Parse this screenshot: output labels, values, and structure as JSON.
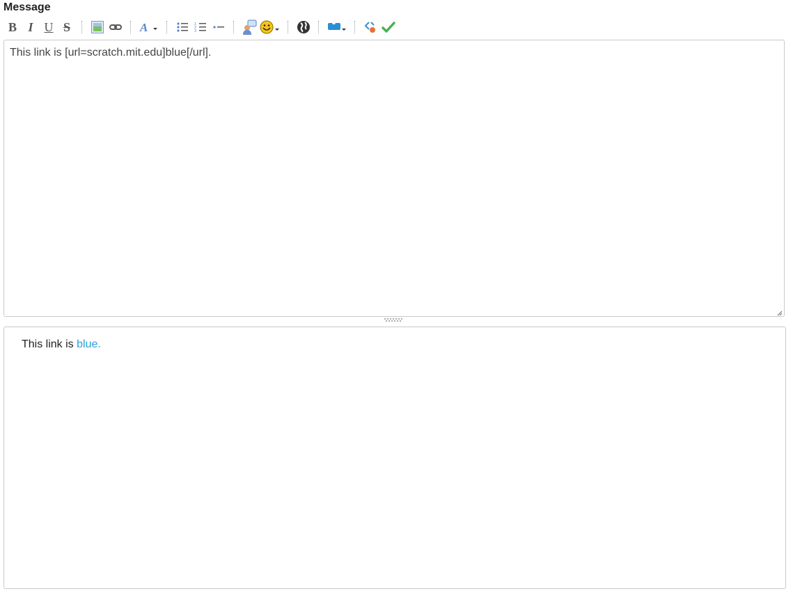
{
  "field_label": "Message",
  "toolbar": {
    "bold_label": "B",
    "italic_label": "I",
    "underline_label": "U",
    "strike_label": "S",
    "buttons": [
      {
        "name": "bold",
        "icon": "bold-icon"
      },
      {
        "name": "italic",
        "icon": "italic-icon"
      },
      {
        "name": "underline",
        "icon": "underline-icon"
      },
      {
        "name": "strikethrough",
        "icon": "strikethrough-icon"
      },
      {
        "name": "image",
        "icon": "image-icon"
      },
      {
        "name": "link",
        "icon": "link-icon"
      },
      {
        "name": "font",
        "icon": "font-icon"
      },
      {
        "name": "bullet-list",
        "icon": "bullet-list-icon"
      },
      {
        "name": "numbered-list",
        "icon": "numbered-list-icon"
      },
      {
        "name": "list-item",
        "icon": "list-item-icon"
      },
      {
        "name": "quote",
        "icon": "quote-icon"
      },
      {
        "name": "smiley",
        "icon": "smiley-icon"
      },
      {
        "name": "wiki",
        "icon": "globe-icon"
      },
      {
        "name": "scratchblocks",
        "icon": "scratch-block-icon"
      },
      {
        "name": "clean",
        "icon": "clean-icon"
      },
      {
        "name": "preview",
        "icon": "checkmark-icon"
      }
    ]
  },
  "editor": {
    "value": "This link is [url=scratch.mit.edu]blue[/url]."
  },
  "preview": {
    "prefix": "This link is ",
    "link_text": "blue",
    "suffix": "."
  },
  "colors": {
    "link": "#2a9fd6",
    "border": "#c9c9c9",
    "icon_gray": "#555555",
    "check_green": "#4caf50"
  }
}
